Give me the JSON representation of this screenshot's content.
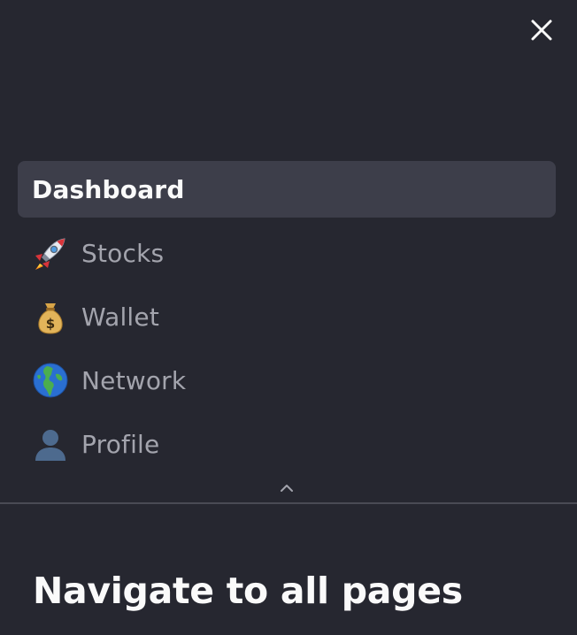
{
  "sidebar": {
    "close_icon": "close-icon",
    "nav": [
      {
        "label": "Dashboard",
        "icon": "",
        "active": true
      },
      {
        "label": "Stocks",
        "icon": "rocket-icon",
        "active": false
      },
      {
        "label": "Wallet",
        "icon": "money-bag-icon",
        "active": false
      },
      {
        "label": "Network",
        "icon": "globe-icon",
        "active": false
      },
      {
        "label": "Profile",
        "icon": "person-silhouette-icon",
        "active": false
      }
    ],
    "collapse_icon": "chevron-up-icon"
  },
  "main": {
    "heading": "Navigate to all pages"
  },
  "colors": {
    "background": "#262730",
    "active_item": "#3d3e4a",
    "active_text": "#fafafa",
    "inactive_text": "#a3a4ad",
    "divider": "#4a4b55"
  }
}
